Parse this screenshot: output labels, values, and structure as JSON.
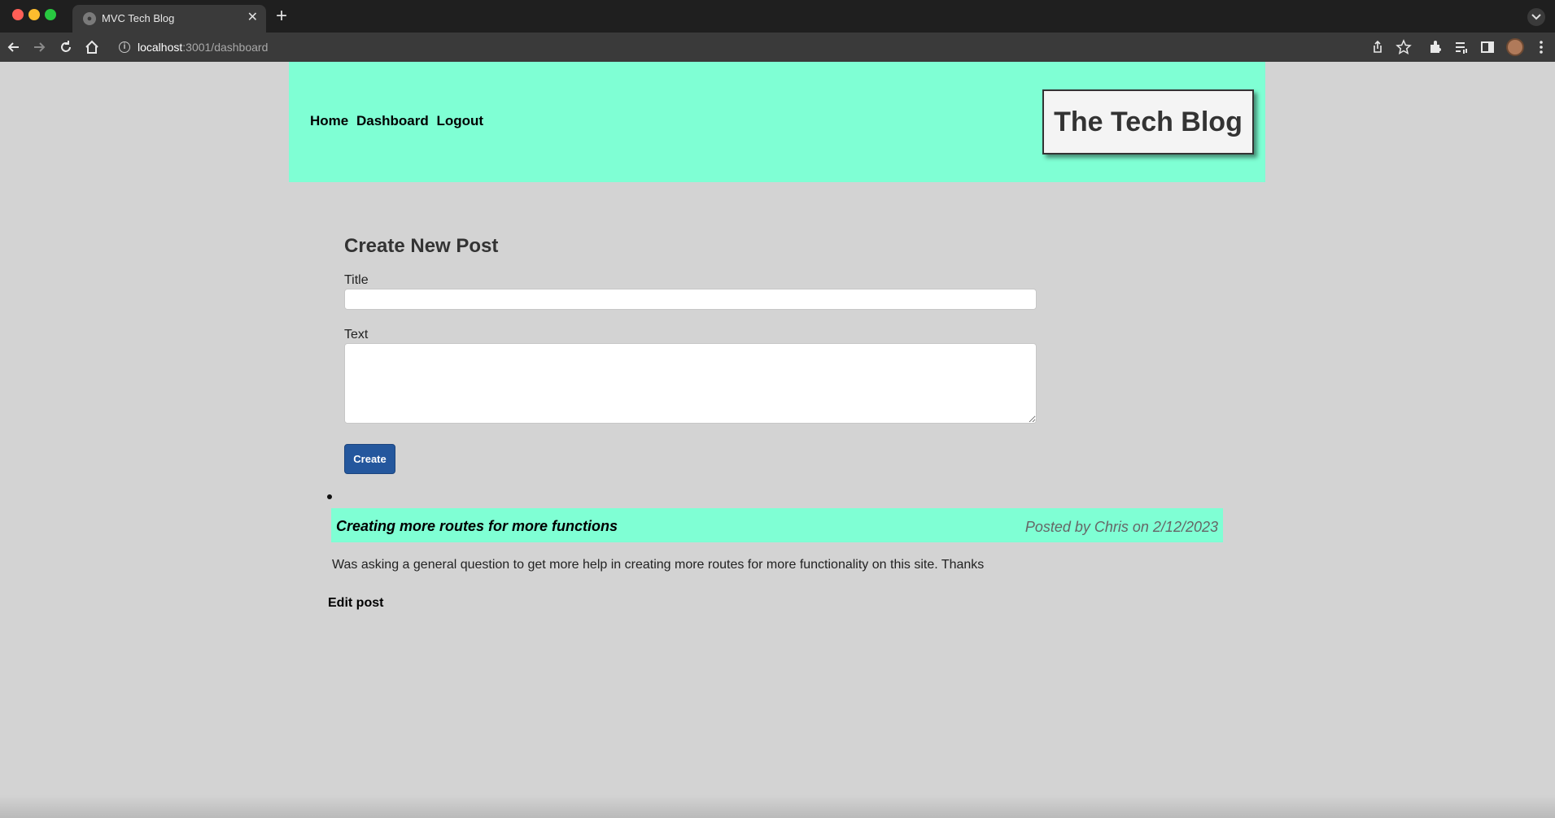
{
  "browser": {
    "tab_title": "MVC Tech Blog",
    "url_host": "localhost",
    "url_path": ":3001/dashboard"
  },
  "header": {
    "nav": [
      "Home",
      "Dashboard",
      "Logout"
    ],
    "brand": "The Tech Blog",
    "color": "#7fffd4"
  },
  "form": {
    "heading": "Create New Post",
    "title_label": "Title",
    "title_value": "",
    "text_label": "Text",
    "text_value": "",
    "submit_label": "Create",
    "button_color": "#24579d"
  },
  "posts": [
    {
      "title": "Creating more routes for more functions",
      "meta": "Posted by Chris on 2/12/2023",
      "body": "Was asking a general question to get more help in creating more routes for more functionality on this site. Thanks",
      "edit_label": "Edit post"
    }
  ]
}
